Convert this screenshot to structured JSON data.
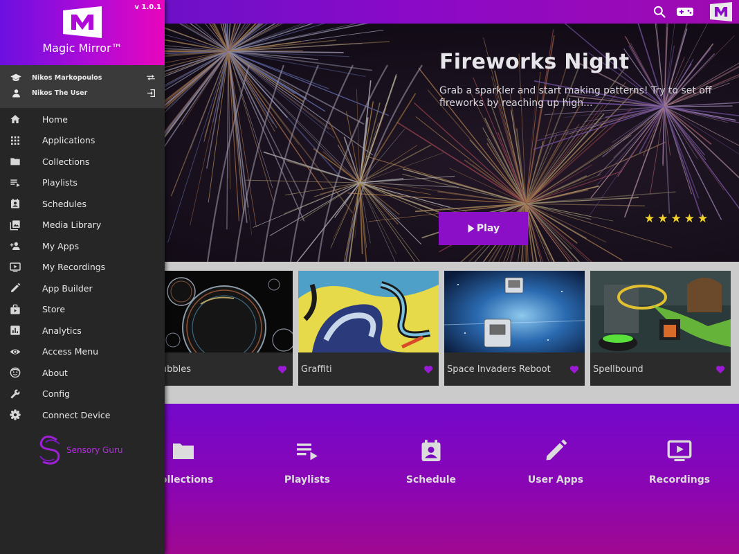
{
  "drawer": {
    "version": "v 1.0.1",
    "app_name": "Magic Mirror™",
    "users": [
      {
        "name": "Nikos Markopoulos",
        "icon": "graduation-cap-icon",
        "action_icon": "swap-icon"
      },
      {
        "name": "Nikos The User",
        "icon": "person-icon",
        "action_icon": "logout-icon"
      }
    ],
    "nav": [
      {
        "label": "Home",
        "icon": "home-icon"
      },
      {
        "label": "Applications",
        "icon": "apps-grid-icon"
      },
      {
        "label": "Collections",
        "icon": "folder-icon"
      },
      {
        "label": "Playlists",
        "icon": "playlist-icon"
      },
      {
        "label": "Schedules",
        "icon": "schedule-icon"
      },
      {
        "label": "Media Library",
        "icon": "photo-library-icon"
      },
      {
        "label": "My Apps",
        "icon": "person-add-icon"
      },
      {
        "label": "My Recordings",
        "icon": "recording-tv-icon"
      },
      {
        "label": "App Builder",
        "icon": "pencil-icon"
      },
      {
        "label": "Store",
        "icon": "store-bag-icon"
      },
      {
        "label": "Analytics",
        "icon": "analytics-icon"
      },
      {
        "label": "Access Menu",
        "icon": "eye-icon"
      },
      {
        "label": "About",
        "icon": "face-icon"
      },
      {
        "label": "Config",
        "icon": "wrench-icon"
      },
      {
        "label": "Connect Device",
        "icon": "gear-icon"
      }
    ],
    "brand": "Sensory Guru"
  },
  "hero": {
    "title": "Fireworks Night",
    "description": "Grab a sparkler and start making patterns! Try to set off fireworks by reaching up high...",
    "play_label": "Play",
    "rating": 5
  },
  "cards": [
    {
      "name": "Bubbles"
    },
    {
      "name": "Graffiti"
    },
    {
      "name": "Space Invaders Reboot"
    },
    {
      "name": "Spellbound"
    }
  ],
  "quick_links": [
    {
      "label": "Collections",
      "icon": "folder-icon"
    },
    {
      "label": "Playlists",
      "icon": "playlist-icon"
    },
    {
      "label": "Schedule",
      "icon": "schedule-icon"
    },
    {
      "label": "User Apps",
      "icon": "pencil-icon"
    },
    {
      "label": "Recordings",
      "icon": "recording-tv-icon"
    }
  ],
  "colors": {
    "accent": "#8c0fc8",
    "drawer_bg": "#262626",
    "heart": "#9b1ad6",
    "star": "#f0d22a"
  }
}
